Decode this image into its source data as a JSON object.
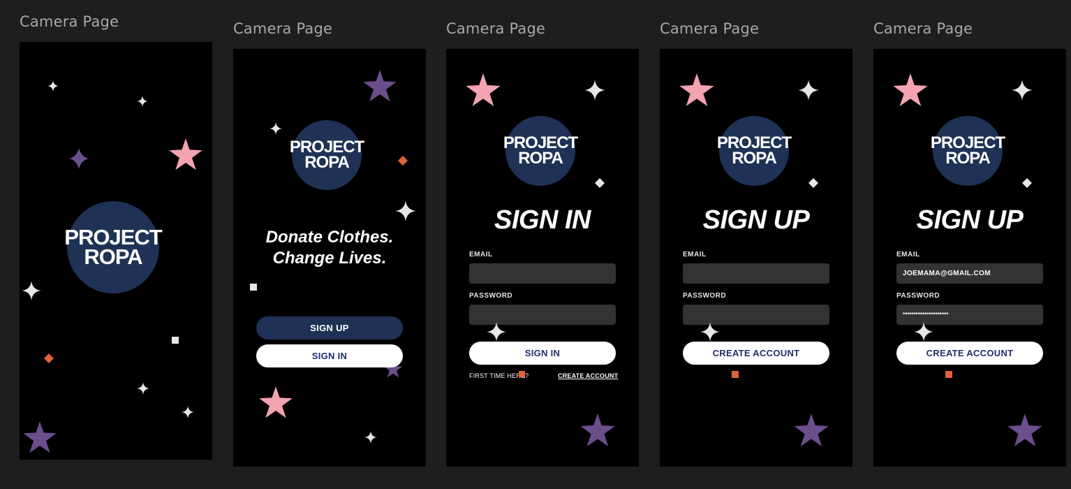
{
  "frames": [
    {
      "label": "Camera Page"
    },
    {
      "label": "Camera Page"
    },
    {
      "label": "Camera Page"
    },
    {
      "label": "Camera Page"
    },
    {
      "label": "Camera Page"
    }
  ],
  "logo": {
    "line1": "PROJECT",
    "line2": "ROPA"
  },
  "welcome": {
    "tagline_line1": "Donate Clothes.",
    "tagline_line2": "Change Lives.",
    "sign_up_label": "SIGN UP",
    "sign_in_label": "SIGN IN"
  },
  "signin": {
    "title": "SIGN IN",
    "email_label": "EMAIL",
    "email_value": "",
    "password_label": "PASSWORD",
    "password_value": "",
    "button_label": "SIGN IN",
    "first_time": "FIRST TIME HERE?",
    "create_link": "CREATE ACCOUNT"
  },
  "signup_empty": {
    "title": "SIGN UP",
    "email_label": "EMAIL",
    "email_value": "",
    "password_label": "PASSWORD",
    "password_value": "",
    "button_label": "CREATE ACCOUNT"
  },
  "signup_filled": {
    "title": "SIGN UP",
    "email_label": "EMAIL",
    "email_value": "JOEMAMA@GMAIL.COM",
    "password_label": "PASSWORD",
    "password_value": "*********************",
    "button_label": "CREATE ACCOUNT"
  },
  "colors": {
    "background": "#1e1e1e",
    "frame": "#000000",
    "navy": "#1f3255",
    "pink": "#f4a3b0",
    "purple": "#6b4e8c",
    "orange": "#e0603a",
    "sparkle": "#e6e6e6"
  }
}
